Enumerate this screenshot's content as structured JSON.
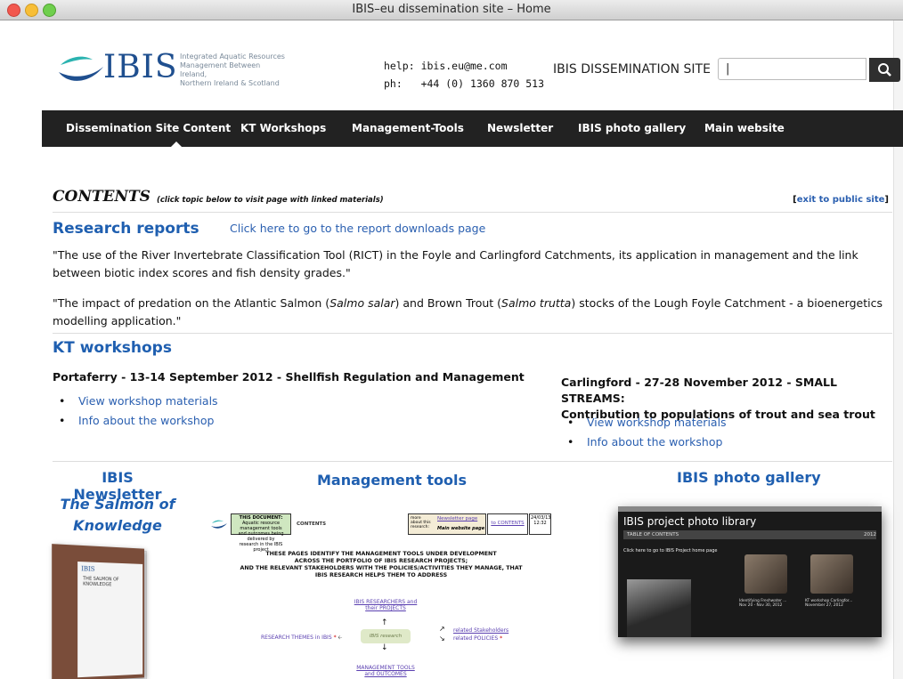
{
  "window": {
    "title": "IBIS–eu dissemination site – Home"
  },
  "header": {
    "logo_text": "IBIS",
    "logo_desc": [
      "Integrated Aquatic Resources",
      "Management Between Ireland,",
      "Northern Ireland & Scotland"
    ],
    "help_label": "help:",
    "help_value": "ibis.eu@me.com",
    "phone_label": "ph:",
    "phone_value": "+44 (0) 1360 870 513",
    "site_label": "IBIS DISSEMINATION SITE",
    "search": {
      "value": "|",
      "placeholder": ""
    }
  },
  "nav": {
    "items": [
      "Dissemination Site Content",
      "KT Workshops",
      "Management-Tools",
      "Newsletter",
      "IBIS photo gallery",
      "Main website"
    ],
    "active_index": 0
  },
  "contents": {
    "title": "CONTENTS",
    "subtitle": "(click topic below to visit page with linked materials)",
    "exit_open": "[",
    "exit_link": "exit to public site",
    "exit_close": "]"
  },
  "research": {
    "heading": "Research reports",
    "link": "Click here to go to the report downloads page",
    "report1": "\"The use of the River Invertebrate Classification Tool (RICT) in the Foyle and Carlingford Catchments, its application in management and the link between biotic index scores and fish density grades.\"",
    "report2_a": "\"The impact of predation on the Atlantic Salmon (",
    "report2_b": "Salmo salar",
    "report2_c": ") and Brown Trout (",
    "report2_d": "Salmo trutta",
    "report2_e": ") stocks of the Lough Foyle Catchment - a bioenergetics modelling application.\""
  },
  "workshops": {
    "heading": "KT workshops",
    "left": {
      "title": "Portaferry - 13-14 September 2012 - Shellfish Regulation and Management",
      "links": [
        "View workshop materials",
        "Info about the workshop"
      ]
    },
    "right": {
      "title_line1": "Carlingford - 27-28 November 2012 - SMALL STREAMS:",
      "title_line2": "Contribution to populations of trout and sea trout",
      "links": [
        "View workshop materials",
        "Info about the workshop"
      ]
    }
  },
  "newsletter": {
    "heading": "IBIS Newsletter",
    "subtitle_line1": "The Salmon of",
    "subtitle_line2": "Knowledge",
    "cover_logo": "IBIS",
    "cover_text": "THE SALMON OF KNOWLEDGE"
  },
  "management": {
    "heading": "Management tools",
    "doc_box": [
      "THIS DOCUMENT:",
      "Aquatic resource management tools",
      "and outcomes being delivered by",
      "research in the IBIS project"
    ],
    "contents_label": "CONTENTS",
    "more_label": [
      "more",
      "about this",
      "research:"
    ],
    "newsletter_page": "Newsletter page",
    "main_website_page": "Main website page",
    "to_contents": "to CONTENTS",
    "date": "24/03/13",
    "time": "12:32",
    "heading_lines": [
      "THESE PAGES IDENTIFY THE MANAGEMENT TOOLS UNDER DEVELOPMENT",
      "ACROSS THE PORTFOLIO OF IBIS RESEARCH PROJECTS;",
      "AND THE RELEVANT STAKEHOLDERS WITH THE POLICIES/ACTIVITIES THEY MANAGE, THAT",
      "IBIS RESEARCH HELPS THEM TO ADDRESS"
    ],
    "researchers": [
      "IBIS RESEARCHERS and",
      "their PROJECTS"
    ],
    "themes": "RESEARCH THEMES in IBIS",
    "research_center": "IBIS research",
    "stakeholders": "related Stakeholders",
    "policies": "related POLICIES",
    "tools": [
      "MANAGEMENT TOOLS",
      "and OUTCOMES"
    ]
  },
  "gallery": {
    "heading": "IBIS photo gallery",
    "title": "IBIS project photo library",
    "toc": "TABLE OF CONTENTS",
    "year": "2012",
    "home_link": "Click here to go to IBIS Project home page",
    "captions": [
      "Identifying Freshwater ... Nov 20 - Nov 30, 2012",
      "KT workshop Carlingfor... November 27, 2012"
    ]
  },
  "colors": {
    "accent": "#1f5fb0",
    "nav_bg": "#222222",
    "link": "#2a5fb0"
  }
}
